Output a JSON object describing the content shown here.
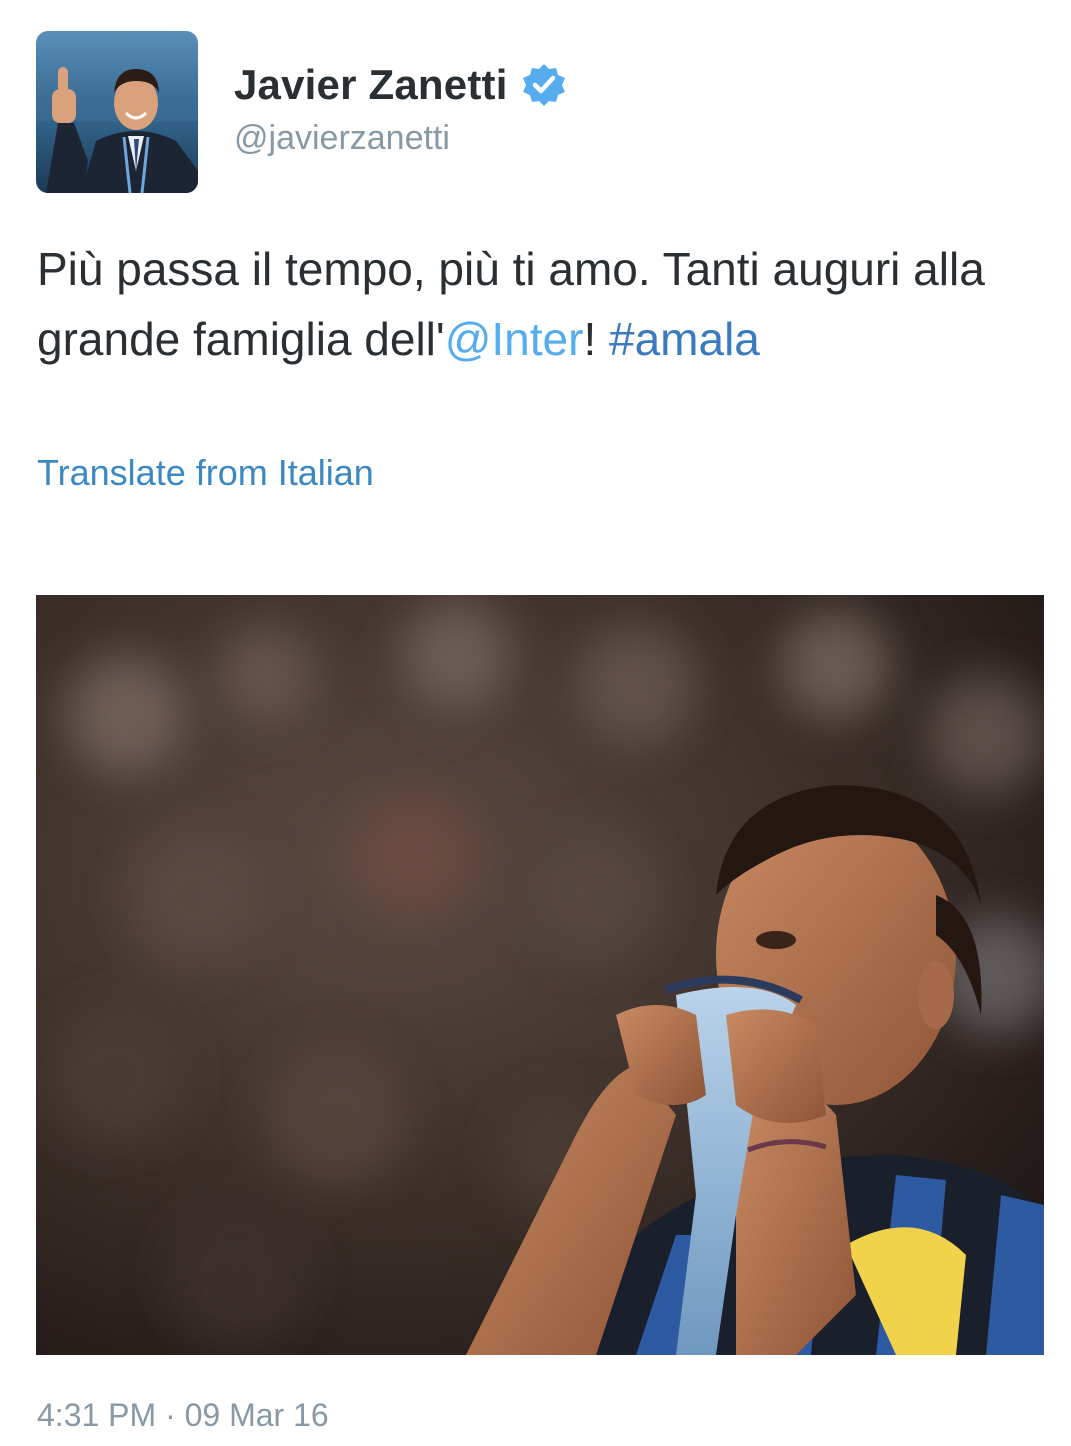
{
  "author": {
    "display_name": "Javier Zanetti",
    "handle": "@javierzanetti",
    "verified": true,
    "avatar_icon": "profile-photo"
  },
  "tweet": {
    "text_before_mention": "Più passa il tempo, più ti amo. Tanti auguri alla grande famiglia dell'",
    "mention": "@Inter",
    "text_after_mention": "! ",
    "hashtag": "#amala",
    "translate_label": "Translate from Italian",
    "timestamp": "4:31 PM · 09 Mar 16"
  },
  "colors": {
    "text": "#292f33",
    "muted": "#8899a6",
    "link": "#55acee",
    "hashtag": "#3a7bbf",
    "verified_badge": "#55acee"
  }
}
